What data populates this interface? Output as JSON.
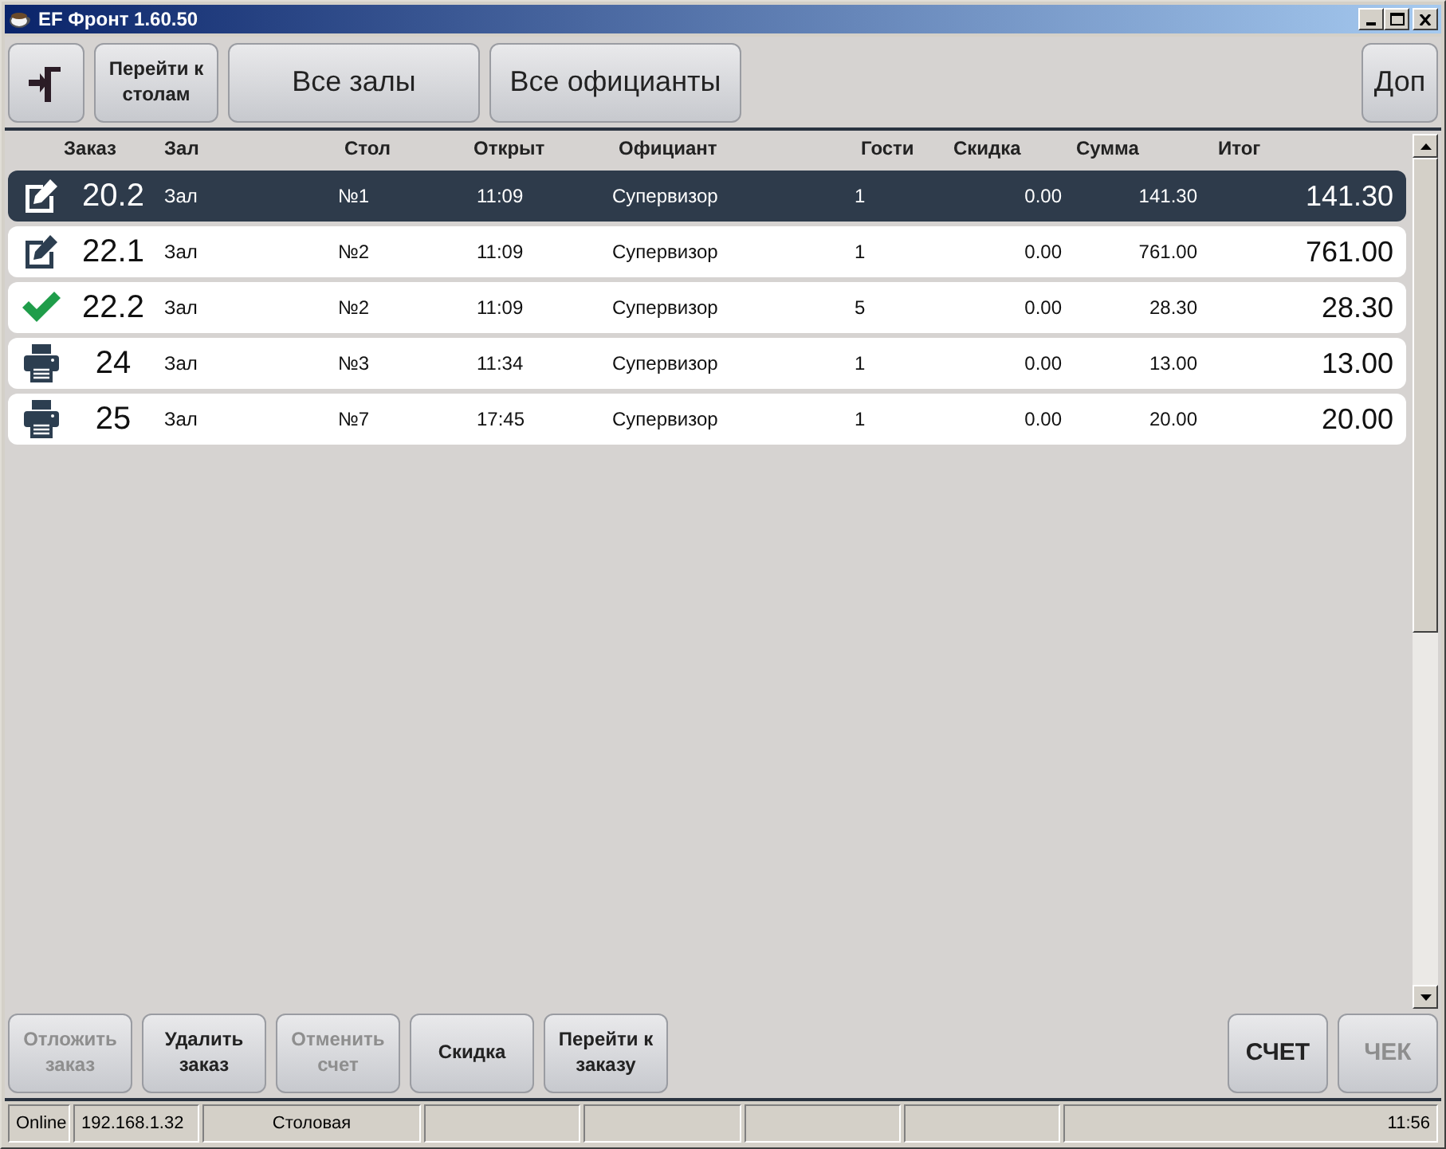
{
  "window": {
    "title": "EF Фронт 1.60.50"
  },
  "toolbar": [
    {
      "kind": "exit"
    },
    {
      "kind": "small",
      "label": "Перейти к\nстолам"
    },
    {
      "kind": "wide",
      "label": "Все залы"
    },
    {
      "kind": "wide",
      "label": "Все официанты"
    },
    {
      "kind": "spacer"
    },
    {
      "kind": "large",
      "label": "Доп"
    }
  ],
  "table": {
    "columns": [
      "Заказ",
      "Зал",
      "Стол",
      "Открыт",
      "Официант",
      "Гости",
      "Скидка",
      "Сумма",
      "Итог"
    ],
    "rows": [
      {
        "kind": "edit",
        "number": "20.2",
        "hall": "Зал",
        "table": "№1",
        "opened": "11:09",
        "waiter": "Супервизор",
        "guests": "1",
        "discount": "0.00",
        "sum": "141.30",
        "total": "141.30",
        "selected": true
      },
      {
        "kind": "edit",
        "number": "22.1",
        "hall": "Зал",
        "table": "№2",
        "opened": "11:09",
        "waiter": "Супервизор",
        "guests": "1",
        "discount": "0.00",
        "sum": "761.00",
        "total": "761.00",
        "selected": false
      },
      {
        "kind": "done",
        "number": "22.2",
        "hall": "Зал",
        "table": "№2",
        "opened": "11:09",
        "waiter": "Супервизор",
        "guests": "5",
        "discount": "0.00",
        "sum": "28.30",
        "total": "28.30",
        "selected": false
      },
      {
        "kind": "printed",
        "number": "24",
        "hall": "Зал",
        "table": "№3",
        "opened": "11:34",
        "waiter": "Супервизор",
        "guests": "1",
        "discount": "0.00",
        "sum": "13.00",
        "total": "13.00",
        "selected": false
      },
      {
        "kind": "printed",
        "number": "25",
        "hall": "Зал",
        "table": "№7",
        "opened": "17:45",
        "waiter": "Супервизор",
        "guests": "1",
        "discount": "0.00",
        "sum": "20.00",
        "total": "20.00",
        "selected": false
      }
    ]
  },
  "actions": [
    {
      "kind": "small",
      "label": "Отложить\nзаказ",
      "disabled": true
    },
    {
      "kind": "small",
      "label": "Удалить\nзаказ",
      "disabled": false
    },
    {
      "kind": "small",
      "label": "Отменить\nсчет",
      "disabled": true
    },
    {
      "kind": "small",
      "label": "Скидка",
      "disabled": false
    },
    {
      "kind": "small",
      "label": "Перейти к\nзаказу",
      "disabled": false
    },
    {
      "kind": "spacer"
    },
    {
      "kind": "bill",
      "label": "СЧЕТ",
      "disabled": false
    },
    {
      "kind": "bill",
      "label": "ЧЕК",
      "disabled": true
    }
  ],
  "status_bar": {
    "connection": "Online",
    "address": "192.168.1.32",
    "place": "Столовая",
    "time": "11:56"
  }
}
